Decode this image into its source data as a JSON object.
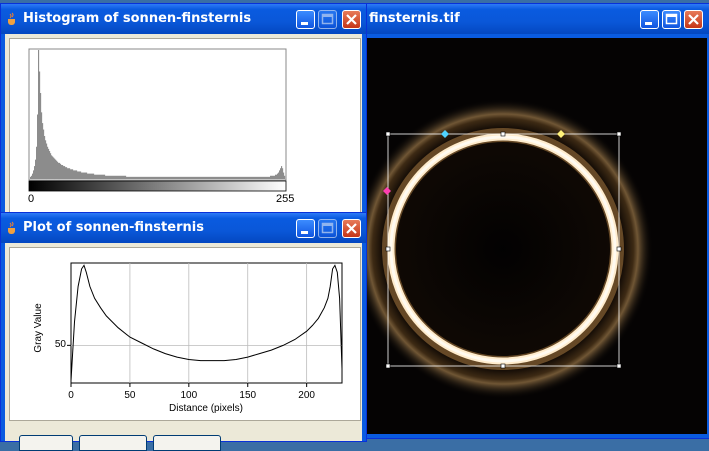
{
  "image_window": {
    "title": "finsternis.tif"
  },
  "histogram_window": {
    "title": "Histogram of sonnen-finsternis",
    "axis_min": "0",
    "axis_max": "255"
  },
  "plot_window": {
    "title": "Plot of sonnen-finsternis",
    "ylabel": "Gray Value",
    "xlabel": "Distance (pixels)",
    "y_tick": "50",
    "x_ticks": [
      "0",
      "50",
      "100",
      "150",
      "200"
    ]
  },
  "icons": {
    "app": "java-cup-icon",
    "minimize": "minimize-icon",
    "maximize": "maximize-icon",
    "close": "close-icon"
  },
  "chart_data": [
    {
      "type": "bar",
      "title": "",
      "x_range": [
        0,
        255
      ],
      "note_values": "approximate histogram counts (relative)",
      "values": [
        2,
        3,
        5,
        8,
        12,
        18,
        30,
        60,
        120,
        100,
        80,
        62,
        52,
        46,
        40,
        36,
        33,
        30,
        28,
        26,
        24,
        22,
        21,
        20,
        19,
        18,
        17,
        16,
        15,
        15,
        14,
        13,
        13,
        12,
        12,
        11,
        11,
        10,
        10,
        10,
        9,
        9,
        9,
        8,
        8,
        8,
        8,
        7,
        7,
        7,
        7,
        6,
        6,
        6,
        6,
        6,
        6,
        5,
        5,
        5,
        5,
        5,
        5,
        5,
        4,
        4,
        4,
        4,
        4,
        4,
        4,
        4,
        4,
        4,
        4,
        3,
        3,
        3,
        3,
        3,
        3,
        3,
        3,
        3,
        3,
        3,
        3,
        3,
        3,
        3,
        3,
        3,
        3,
        3,
        3,
        3,
        2,
        2,
        2,
        2,
        2,
        2,
        2,
        2,
        2,
        2,
        2,
        2,
        2,
        2,
        2,
        2,
        2,
        2,
        2,
        2,
        2,
        2,
        2,
        2,
        2,
        2,
        2,
        2,
        2,
        2,
        2,
        2,
        2,
        2,
        2,
        2,
        2,
        2,
        2,
        2,
        2,
        2,
        2,
        2,
        2,
        2,
        2,
        2,
        2,
        2,
        2,
        2,
        2,
        2,
        2,
        2,
        2,
        2,
        2,
        2,
        2,
        2,
        2,
        2,
        2,
        2,
        2,
        2,
        2,
        2,
        2,
        2,
        2,
        2,
        2,
        2,
        2,
        2,
        2,
        2,
        2,
        2,
        2,
        2,
        2,
        2,
        2,
        2,
        2,
        2,
        2,
        2,
        2,
        2,
        2,
        2,
        2,
        2,
        2,
        2,
        2,
        2,
        2,
        2,
        2,
        2,
        2,
        2,
        2,
        2,
        2,
        2,
        2,
        2,
        2,
        2,
        2,
        2,
        2,
        2,
        2,
        2,
        2,
        2,
        2,
        2,
        2,
        2,
        2,
        2,
        2,
        2,
        2,
        2,
        2,
        2,
        2,
        2,
        2,
        2,
        2,
        2,
        2,
        2,
        3,
        3,
        3,
        3,
        3,
        4,
        4,
        5,
        6,
        8,
        10,
        12,
        10,
        6,
        3
      ]
    },
    {
      "type": "line",
      "xlabel": "Distance (pixels)",
      "ylabel": "Gray Value",
      "xlim": [
        0,
        230
      ],
      "x": [
        0,
        3,
        6,
        9,
        11,
        13,
        16,
        20,
        25,
        30,
        40,
        50,
        60,
        70,
        80,
        90,
        100,
        110,
        120,
        130,
        140,
        150,
        160,
        170,
        180,
        190,
        200,
        205,
        210,
        215,
        218,
        220,
        222,
        224,
        226,
        228,
        230
      ],
      "y": [
        20,
        70,
        100,
        115,
        118,
        112,
        100,
        90,
        82,
        75,
        65,
        57,
        52,
        47,
        43,
        40,
        38,
        37,
        37,
        37,
        38,
        40,
        43,
        46,
        50,
        55,
        62,
        67,
        73,
        82,
        90,
        100,
        115,
        118,
        112,
        90,
        30
      ]
    }
  ]
}
